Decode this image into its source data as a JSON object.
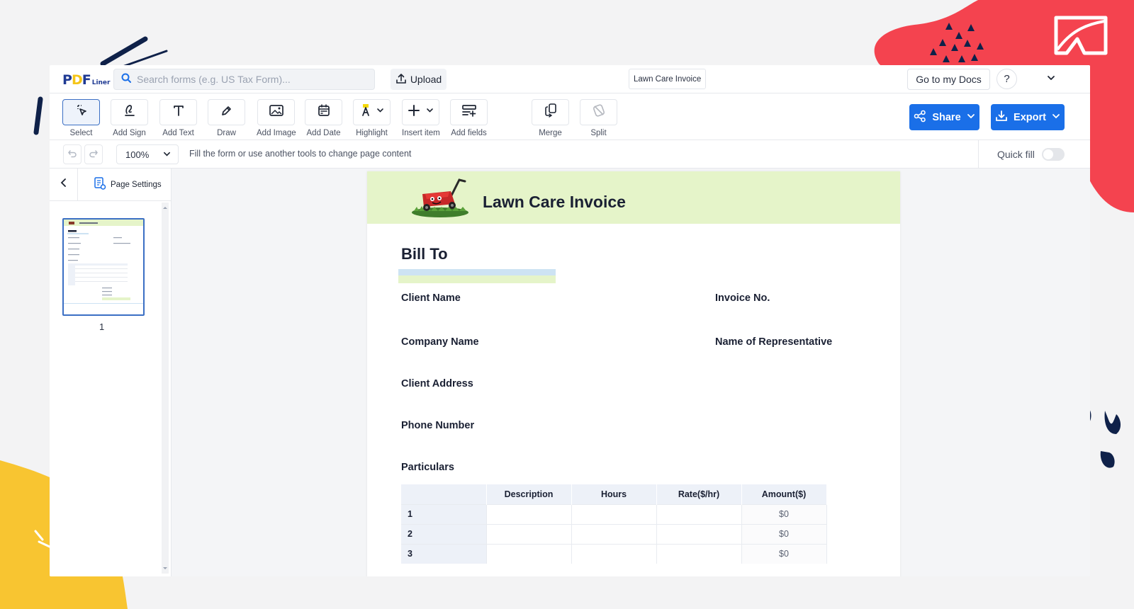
{
  "topbar": {
    "logo_main": "PDF",
    "logo_sub": "Liner",
    "search_placeholder": "Search forms (e.g. US Tax Form)...",
    "upload_label": "Upload",
    "document_title": "Lawn Care Invoice",
    "my_docs_label": "Go to my Docs",
    "help_label": "?"
  },
  "toolbar": {
    "tools": [
      {
        "label": "Select"
      },
      {
        "label": "Add Sign"
      },
      {
        "label": "Add Text"
      },
      {
        "label": "Draw"
      },
      {
        "label": "Add Image"
      },
      {
        "label": "Add Date"
      },
      {
        "label": "Highlight"
      },
      {
        "label": "Insert item"
      },
      {
        "label": "Add fields"
      },
      {
        "label": "Merge"
      },
      {
        "label": "Split"
      }
    ],
    "share_label": "Share",
    "export_label": "Export"
  },
  "subbar": {
    "zoom": "100%",
    "hint": "Fill the form or use another tools to change page content",
    "quick_fill_label": "Quick fill"
  },
  "sidebar": {
    "page_settings_label": "Page Settings",
    "page_number": "1"
  },
  "document": {
    "title": "Lawn Care Invoice",
    "bill_to": "Bill To",
    "fields": {
      "client_name": "Client Name",
      "invoice_no": "Invoice No.",
      "company_name": "Company Name",
      "representative": "Name of Representative",
      "client_address": "Client Address",
      "phone_number": "Phone Number",
      "particulars": "Particulars"
    },
    "table": {
      "headers": [
        "",
        "Description",
        "Hours",
        "Rate($/hr)",
        "Amount($)"
      ],
      "rows": [
        {
          "num": "1",
          "amount": "$0"
        },
        {
          "num": "2",
          "amount": "$0"
        },
        {
          "num": "3",
          "amount": "$0"
        }
      ]
    }
  },
  "colors": {
    "accent": "#1a6fe8",
    "header_green": "#e5f4c9",
    "deco_red": "#f4434f",
    "deco_yellow": "#f8c531",
    "deco_navy": "#0f2149"
  }
}
